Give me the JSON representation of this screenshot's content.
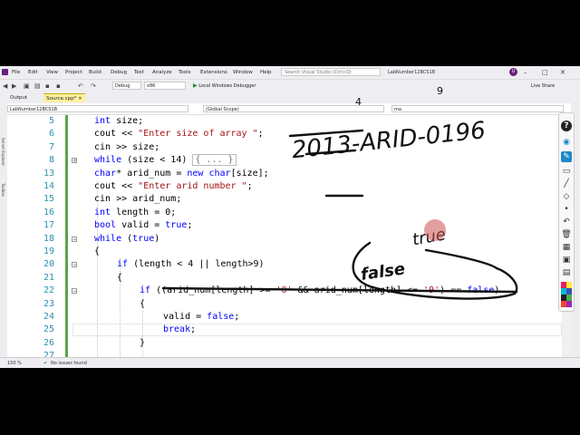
{
  "menu": {
    "items": [
      "File",
      "Edit",
      "View",
      "Project",
      "Build",
      "Debug",
      "Test",
      "Analyze",
      "Tools",
      "Extensions",
      "Window",
      "Help"
    ],
    "search_placeholder": "Search Visual Studio (Ctrl+Q)",
    "project_name": "LabNumber12BCS1B",
    "avatar_initial": "U"
  },
  "toolbar": {
    "config": "Debug",
    "platform": "x86",
    "debugger_label": "Local Windows Debugger",
    "live_share": "Live Share"
  },
  "tabs": {
    "output": "Output",
    "source": "Source.cpp*"
  },
  "navbar": {
    "project": "LabNumber12BCS1B",
    "scope": "(Global Scope)",
    "member": "ma"
  },
  "editor": {
    "lines": [
      {
        "n": "5",
        "code": "int size;"
      },
      {
        "n": "6",
        "code": "cout << \"Enter size of array \";"
      },
      {
        "n": "7",
        "code": "cin >> size;"
      },
      {
        "n": "8",
        "code": "while (size < 14)"
      },
      {
        "n": "13",
        "code": "char* arid_num = new char[size];"
      },
      {
        "n": "14",
        "code": "cout << \"Enter arid number \";"
      },
      {
        "n": "15",
        "code": "cin >> arid_num;"
      },
      {
        "n": "16",
        "code": "int length = 0;"
      },
      {
        "n": "17",
        "code": "bool valid = true;"
      },
      {
        "n": "18",
        "code": "while (true)"
      },
      {
        "n": "19",
        "code": "{"
      },
      {
        "n": "20",
        "code": "if (length < 4 || length>9)"
      },
      {
        "n": "21",
        "code": "{"
      },
      {
        "n": "22",
        "code": "if ((arid_num[length] >= '0' && arid_num[length] <= '9') == false)"
      },
      {
        "n": "23",
        "code": "{"
      },
      {
        "n": "24",
        "code": "valid = false;"
      },
      {
        "n": "25",
        "code": "break;"
      },
      {
        "n": "26",
        "code": "}"
      },
      {
        "n": "27",
        "code": ""
      }
    ],
    "collapsed_block": "{ ... }"
  },
  "status": {
    "zoom": "150 %",
    "issues": "No issues found"
  },
  "annotations": {
    "top_text": "2013-ARID-0196",
    "superscripts": [
      "4",
      "9"
    ],
    "true_word": "true",
    "false_word": "false"
  },
  "colors": {
    "keyword": "#0000ff",
    "string": "#a31515",
    "line_number": "#2b91af",
    "change_bar": "#57a64a",
    "vs_purple": "#68217a"
  }
}
